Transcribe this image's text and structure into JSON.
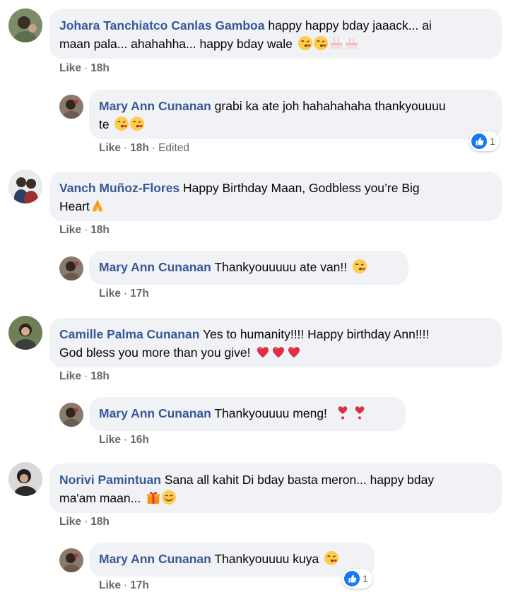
{
  "comments": [
    {
      "author": "Johara Tanchiatco Canlas Gamboa",
      "text_line1": " happy happy bday jaaack... ai",
      "text_line2": "maan pala... ahahahha... happy bday wale",
      "like": "Like",
      "time": "18h",
      "emojis": [
        "kiss-face",
        "kiss-face",
        "birthday-cake",
        "birthday-cake"
      ]
    },
    {
      "author": "Mary Ann Cunanan",
      "text_line1": " grabi ka ate joh hahahahaha thankyouuuu",
      "text_line2": "te",
      "like": "Like",
      "time": "18h",
      "edited": "Edited",
      "reaction_count": "1",
      "emojis": [
        "kiss-face",
        "kiss-face"
      ]
    },
    {
      "author": "Vanch Muñoz-Flores",
      "text_line1": " Happy Birthday Maan, Godbless you’re Big",
      "text_line2": "Heart",
      "like": "Like",
      "time": "18h",
      "emojis": [
        "folded-hands"
      ]
    },
    {
      "author": "Mary Ann Cunanan",
      "text_line1": " Thankyouuuuu ate van!!",
      "like": "Like",
      "time": "17h",
      "emojis": [
        "kiss-face"
      ]
    },
    {
      "author": "Camille Palma Cunanan",
      "text_line1": " Yes to humanity!!!! Happy birthday Ann!!!!",
      "text_line2": "God bless you more than you give!",
      "like": "Like",
      "time": "18h",
      "emojis": [
        "heart-exclamation",
        "heart-exclamation",
        "heart-exclamation"
      ]
    },
    {
      "author": "Mary Ann Cunanan",
      "text_line1": " Thankyouuuu meng!",
      "like": "Like",
      "time": "16h",
      "emojis": [
        "heart-exclamation-red",
        "heart-exclamation-red"
      ]
    },
    {
      "author": "Norivi Pamintuan",
      "text_line1": " Sana all kahit Di bday basta meron... happy bday",
      "text_line2": "ma'am maan...",
      "like": "Like",
      "time": "18h",
      "emojis": [
        "gift",
        "smiling-face"
      ]
    },
    {
      "author": "Mary Ann Cunanan",
      "text_line1": " Thankyouuuu kuya",
      "like": "Like",
      "time": "17h",
      "reaction_count": "1",
      "emojis": [
        "kiss-face"
      ]
    }
  ],
  "colors": {
    "author": "#385898",
    "bubble": "#f0f2f5",
    "meta": "#65676b",
    "reaction_blue": "#1877f2"
  },
  "separator": "·"
}
